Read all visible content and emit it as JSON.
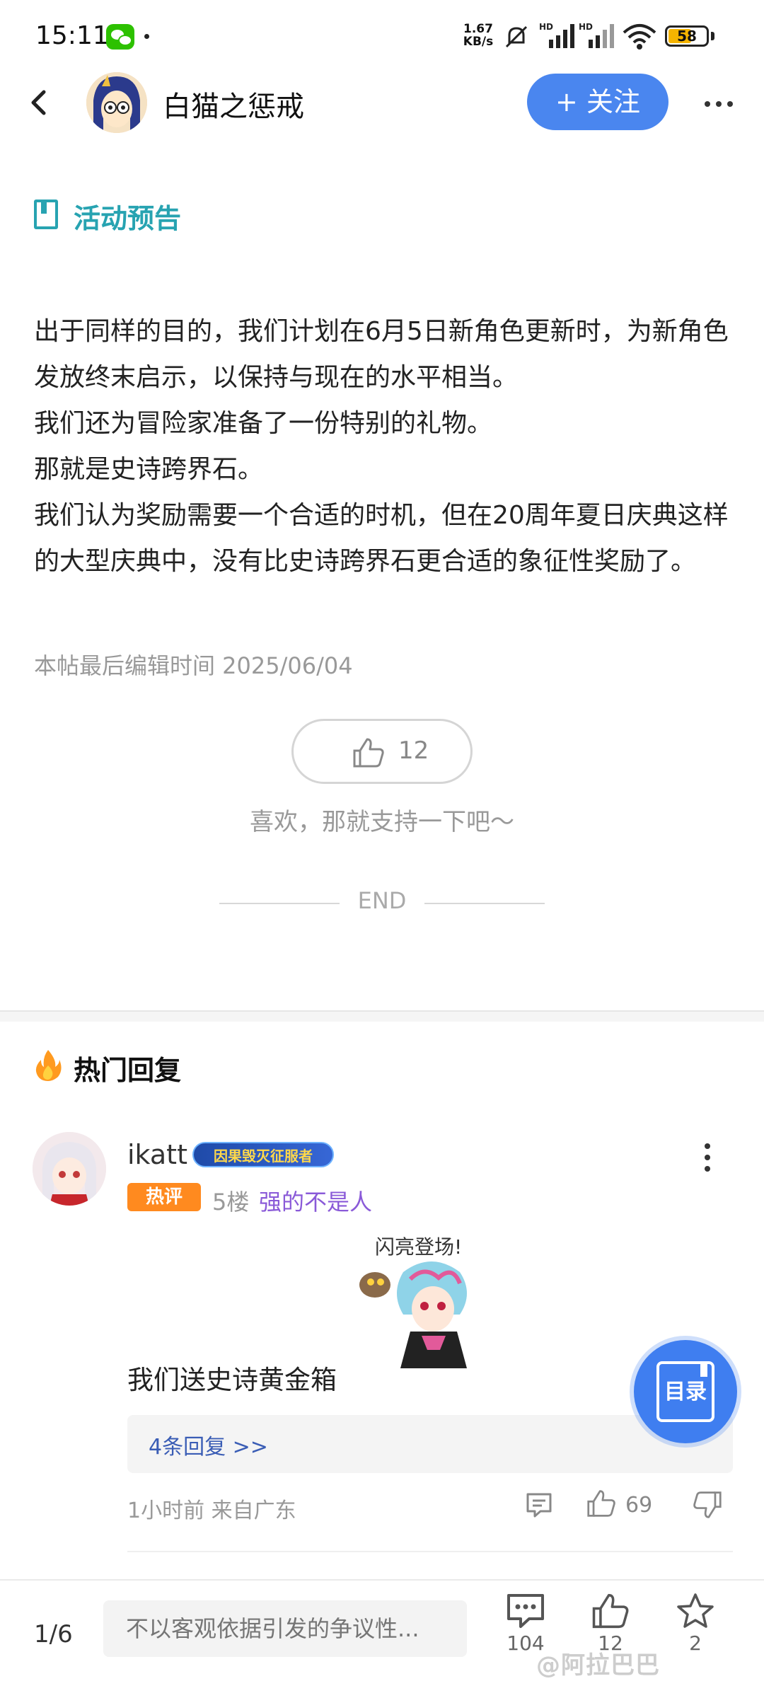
{
  "status_bar": {
    "time": "15:11",
    "net_speed_value": "1.67",
    "net_speed_unit": "KB/s",
    "battery_level": "58",
    "signal_label": "HD",
    "wifi_label": "6"
  },
  "header": {
    "author_name": "白猫之惩戒",
    "follow_label": "+ 关注"
  },
  "section": {
    "title": "活动预告",
    "accent_color": "#27a3b1"
  },
  "article": {
    "paragraphs": [
      "出于同样的目的，我们计划在6月5日新角色更新时，为新角色发放终末启示，以保持与现在的水平相当。",
      "我们还为冒险家准备了一份特别的礼物。",
      "那就是史诗跨界石。",
      "我们认为奖励需要一个合适的时机，但在20周年夏日庆典这样的大型庆典中，没有比史诗跨界石更合适的象征性奖励了。"
    ],
    "edit_time": "本帖最后编辑时间 2025/06/04",
    "like_count": "12",
    "support_text": "喜欢，那就支持一下吧～",
    "end_text": "END"
  },
  "hot_replies": {
    "title": "热门回复",
    "comment": {
      "username": "ikatt",
      "badge": "因果毁灭征服者",
      "hot_tag": "热评",
      "floor": "5楼",
      "floor_tag": "强的不是人",
      "sticker_text": "闪亮登场!",
      "text": "我们送史诗黄金箱",
      "replies_link": "4条回复 >>",
      "meta": "1小时前 来自广东",
      "like_count": "69"
    }
  },
  "catalog_button": {
    "label": "目录"
  },
  "bottom_bar": {
    "page_indicator": "1/6",
    "input_placeholder": "不以客观依据引发的争议性...",
    "comment_count": "104",
    "like_count": "12",
    "star_count": "2",
    "watermark": "@阿拉巴巴"
  },
  "colors": {
    "follow_button": "#4a86ef",
    "hot_tag": "#ff8a1f",
    "floor_tag": "#8a5ad8",
    "link": "#3a5db5"
  }
}
